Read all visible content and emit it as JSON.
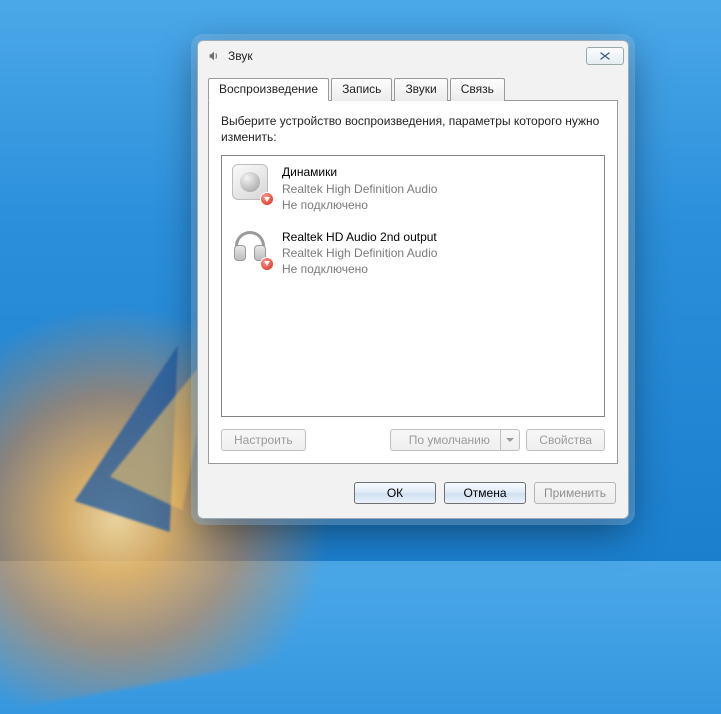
{
  "window": {
    "title": "Звук"
  },
  "tabs": [
    {
      "label": "Воспроизведение",
      "active": true
    },
    {
      "label": "Запись",
      "active": false
    },
    {
      "label": "Звуки",
      "active": false
    },
    {
      "label": "Связь",
      "active": false
    }
  ],
  "instruction": "Выберите устройство воспроизведения, параметры которого нужно изменить:",
  "devices": [
    {
      "name": "Динамики",
      "driver": "Realtek High Definition Audio",
      "status": "Не подключено",
      "icon": "speaker-icon"
    },
    {
      "name": "Realtek HD Audio 2nd output",
      "driver": "Realtek High Definition Audio",
      "status": "Не подключено",
      "icon": "headphones-icon"
    }
  ],
  "panel_buttons": {
    "configure": "Настроить",
    "default": "По умолчанию",
    "properties": "Свойства"
  },
  "footer": {
    "ok": "ОК",
    "cancel": "Отмена",
    "apply": "Применить"
  }
}
